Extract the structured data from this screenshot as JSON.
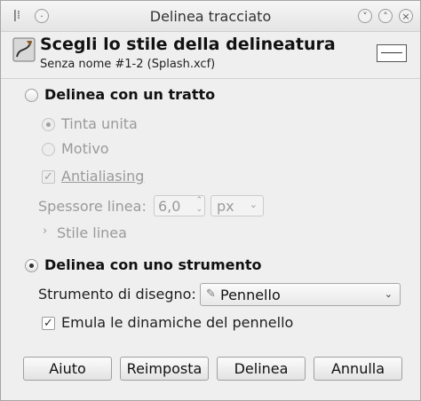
{
  "window": {
    "title": "Delinea tracciato"
  },
  "header": {
    "title": "Scegli lo stile della delineatura",
    "subtitle": "Senza nome #1-2 (Splash.xcf)"
  },
  "stroke_line": {
    "label": "Delinea con un tratto",
    "selected": false,
    "fill_solid": "Tinta unita",
    "fill_pattern": "Motivo",
    "antialiasing": "Antialiasing",
    "antialiasing_checked": true,
    "line_width_label": "Spessore linea:",
    "line_width_value": "6,0",
    "unit": "px",
    "line_style": "Stile linea"
  },
  "stroke_tool": {
    "label": "Delinea con uno strumento",
    "selected": true,
    "paint_tool_label": "Strumento di disegno:",
    "paint_tool_value": "Pennello",
    "emulate_dynamics": "Emula le dinamiche del pennello",
    "emulate_dynamics_checked": true
  },
  "buttons": {
    "help": "Aiuto",
    "reset": "Reimposta",
    "stroke": "Delinea",
    "cancel": "Annulla"
  },
  "icons": {
    "window_menu": "pin-icon",
    "minimize": "minimize-icon",
    "maximize": "maximize-icon",
    "close": "close-icon",
    "header": "stroke-path-icon",
    "paintbrush": "paintbrush-icon",
    "expander": "chevron-right-icon"
  }
}
